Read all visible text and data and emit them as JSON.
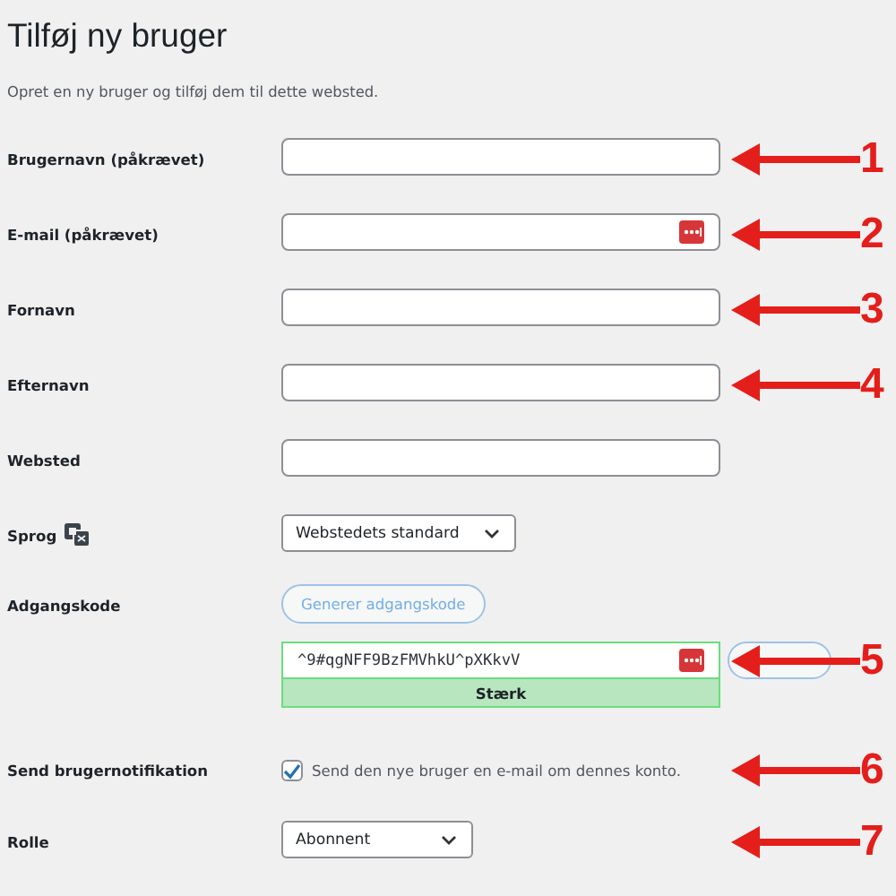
{
  "title": "Tilføj ny bruger",
  "description": "Opret en ny bruger og tilføj dem til dette websted.",
  "rows": [
    {
      "kind": "text",
      "label": "Brugernavn (påkrævet)",
      "annotation": "1"
    },
    {
      "kind": "text",
      "label": "E-mail (påkrævet)",
      "manager_icon": true,
      "annotation": "2"
    },
    {
      "kind": "text",
      "label": "Fornavn",
      "annotation": "3"
    },
    {
      "kind": "text",
      "label": "Efternavn",
      "annotation": "4"
    },
    {
      "kind": "text",
      "label": "Websted"
    },
    {
      "kind": "select",
      "label": "Sprog",
      "label_icon": true,
      "value": "Webstedets standard"
    },
    {
      "kind": "password",
      "label": "Adgangskode",
      "button": "Generer adgangskode",
      "value": "^9#qgNFF9BzFMVhkU^pXKkvV",
      "manager_icon": true,
      "strength": "Stærk",
      "annotation": "5"
    },
    {
      "kind": "checkbox",
      "label": "Send brugernotifikation",
      "checked": true,
      "text": "Send den nye bruger en e-mail om dennes konto.",
      "annotation": "6"
    },
    {
      "kind": "select",
      "label": "Rolle",
      "value": "Abonnent",
      "annotation": "7"
    }
  ]
}
